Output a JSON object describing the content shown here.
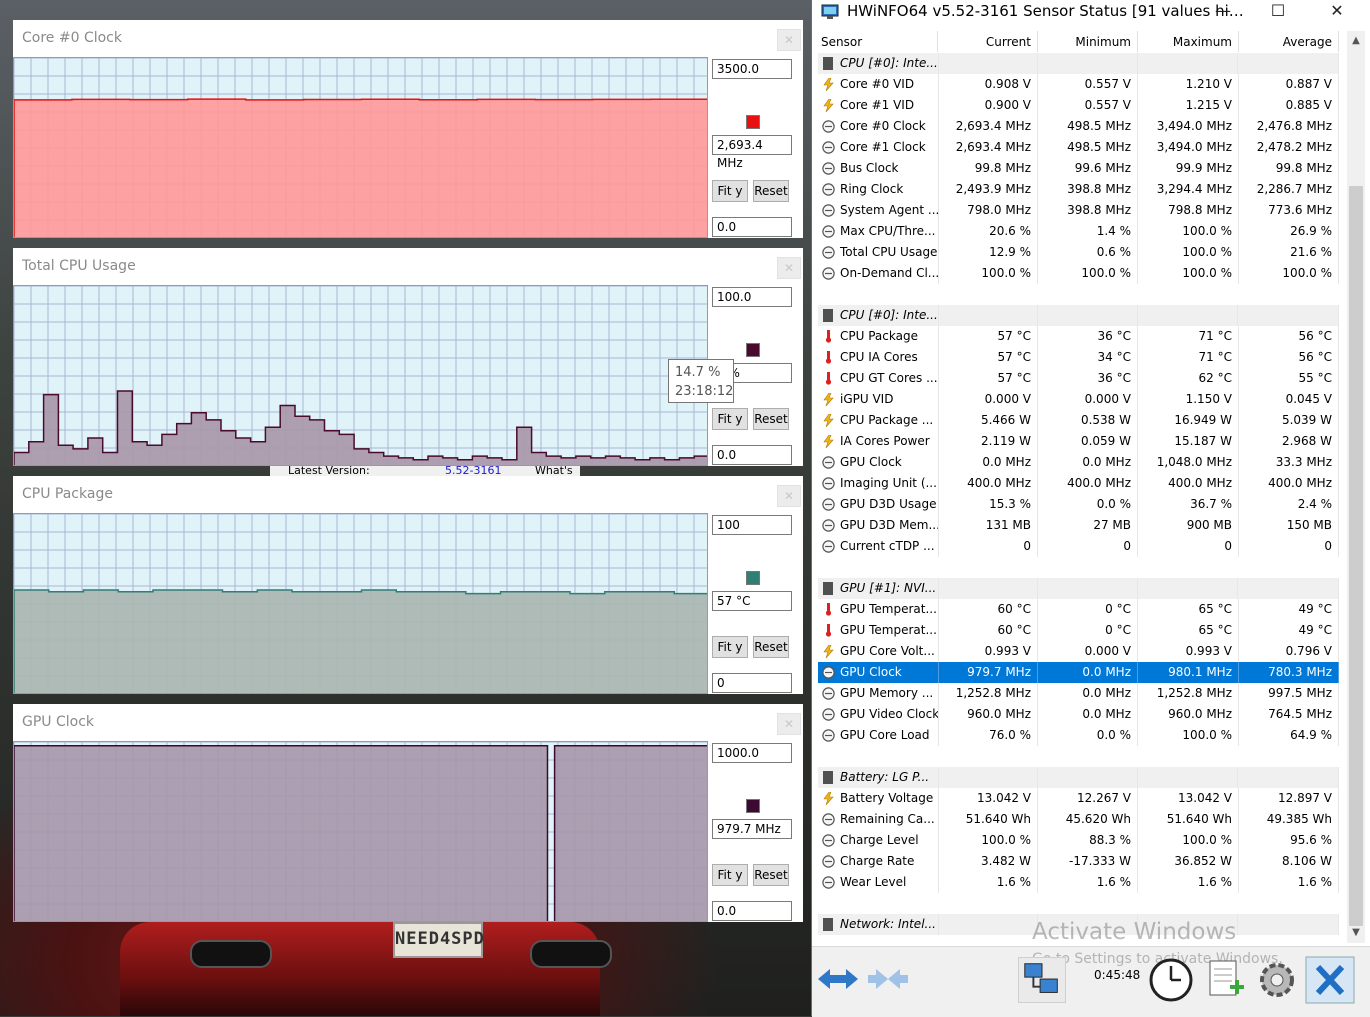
{
  "background": {
    "plate_text": "NEED4SPD",
    "dialog": {
      "latest_version_label": "Latest Version:",
      "latest_version_value": "5.52-3161",
      "whats_label": "What's"
    }
  },
  "graphs": [
    {
      "title": "Core #0 Clock",
      "max": "3500.0",
      "current": "2,693.4 MHz",
      "min": "0.0",
      "fit_label": "Fit y",
      "reset_label": "Reset",
      "color": "#e81010",
      "fill": "#ff9a9a"
    },
    {
      "title": "Total CPU Usage",
      "max": "100.0",
      "current": "12.9 %",
      "current_visible": "9 %",
      "min": "0.0",
      "fit_label": "Fit y",
      "reset_label": "Reset",
      "color": "#4a0a2e",
      "fill": "#a898a8"
    },
    {
      "title": "CPU Package",
      "max": "100",
      "current": "57 °C",
      "min": "0",
      "fit_label": "Fit y",
      "reset_label": "Reset",
      "color": "#2f7f74",
      "fill": "#a9b6b1"
    },
    {
      "title": "GPU Clock",
      "max": "1000.0",
      "current": "979.7 MHz",
      "min": "0.0",
      "fit_label": "Fit y",
      "reset_label": "Reset",
      "color": "#3c0a30",
      "fill": "#a698aa"
    }
  ],
  "tooltip": {
    "value": "14.7 %",
    "time": "23:18:12"
  },
  "chart_data": [
    {
      "type": "area",
      "title": "Core #0 Clock",
      "ylim": [
        0,
        3500
      ],
      "series": [
        {
          "name": "Core #0 Clock",
          "values": [
            2690,
            2700,
            2695,
            2705,
            2690,
            2698,
            2702,
            2693,
            2700,
            2695,
            2699,
            2701,
            2693
          ]
        }
      ]
    },
    {
      "type": "area",
      "title": "Total CPU Usage",
      "ylim": [
        0,
        100
      ],
      "series": [
        {
          "name": "Total CPU Usage",
          "values": [
            8,
            14,
            40,
            12,
            10,
            16,
            8,
            42,
            14,
            12,
            18,
            24,
            30,
            26,
            20,
            16,
            14,
            22,
            34,
            28,
            26,
            20,
            18,
            10,
            8,
            6,
            5,
            4,
            6,
            5,
            4,
            6,
            5,
            4,
            22,
            8,
            6,
            5,
            6,
            5,
            6,
            5,
            4,
            5,
            4,
            5,
            6,
            4
          ]
        }
      ]
    },
    {
      "type": "area",
      "title": "CPU Package",
      "ylim": [
        0,
        100
      ],
      "series": [
        {
          "name": "CPU Package",
          "values": [
            58,
            57,
            58,
            57,
            58,
            58,
            57,
            58,
            57,
            57,
            58,
            57,
            57,
            56,
            57,
            57,
            56,
            57,
            57,
            56,
            57
          ]
        }
      ]
    },
    {
      "type": "area",
      "title": "GPU Clock",
      "ylim": [
        0,
        1000
      ],
      "series": [
        {
          "name": "GPU Clock",
          "values": [
            979.7,
            979.7,
            979.7,
            979.7,
            979.7,
            979.7,
            979.7,
            979.7,
            979.7,
            979.7,
            979.7,
            979.7,
            979.7,
            979.7,
            979.7,
            979.7,
            979.7,
            979.7,
            979.7,
            979.7,
            979.7,
            979.7,
            979.7,
            979.7,
            979.7,
            979.7,
            979.7,
            979.7,
            979.7,
            979.7,
            979.7,
            979.7,
            979.7,
            979.7,
            979.7,
            979.7,
            979.7,
            979.7,
            979.7,
            979.7,
            979.7,
            979.7,
            979.7,
            979.7,
            979.7,
            979.7,
            979.7,
            979.7,
            979.7,
            979.7,
            979.7,
            979.7,
            979.7,
            979.7,
            979.7,
            979.7,
            979.7,
            979.7,
            979.7,
            979.7,
            979.7,
            979.7,
            979.7,
            979.7,
            979.7,
            979.7,
            979.7,
            979.7,
            979.7,
            979.7,
            979.7,
            979.7,
            979.7,
            979.7,
            979.7,
            979.7,
            0,
            979.7,
            979.7,
            979.7,
            979.7,
            979.7,
            979.7,
            979.7,
            979.7,
            979.7,
            979.7,
            979.7,
            979.7,
            979.7,
            979.7,
            979.7,
            979.7,
            979.7,
            979.7,
            979.7,
            979.7,
            979.7,
            979.7,
            979.7
          ]
        }
      ]
    }
  ],
  "hwinfo": {
    "title": "HWiNFO64 v5.52-3161 Sensor Status [91 values hi…",
    "columns": [
      "Sensor",
      "Current",
      "Minimum",
      "Maximum",
      "Average"
    ],
    "rows": [
      {
        "type": "group",
        "name": "CPU [#0]: Inte..."
      },
      {
        "icon": "lightning",
        "name": "Core #0 VID",
        "cur": "0.908 V",
        "min": "0.557 V",
        "max": "1.210 V",
        "avg": "0.887 V"
      },
      {
        "icon": "lightning",
        "name": "Core #1 VID",
        "cur": "0.900 V",
        "min": "0.557 V",
        "max": "1.215 V",
        "avg": "0.885 V"
      },
      {
        "icon": "gauge",
        "name": "Core #0 Clock",
        "cur": "2,693.4 MHz",
        "min": "498.5 MHz",
        "max": "3,494.0 MHz",
        "avg": "2,476.8 MHz"
      },
      {
        "icon": "gauge",
        "name": "Core #1 Clock",
        "cur": "2,693.4 MHz",
        "min": "498.5 MHz",
        "max": "3,494.0 MHz",
        "avg": "2,478.2 MHz"
      },
      {
        "icon": "gauge",
        "name": "Bus Clock",
        "cur": "99.8 MHz",
        "min": "99.6 MHz",
        "max": "99.9 MHz",
        "avg": "99.8 MHz"
      },
      {
        "icon": "gauge",
        "name": "Ring Clock",
        "cur": "2,493.9 MHz",
        "min": "398.8 MHz",
        "max": "3,294.4 MHz",
        "avg": "2,286.7 MHz"
      },
      {
        "icon": "gauge",
        "name": "System Agent ...",
        "cur": "798.0 MHz",
        "min": "398.8 MHz",
        "max": "798.8 MHz",
        "avg": "773.6 MHz"
      },
      {
        "icon": "gauge",
        "name": "Max CPU/Thre...",
        "cur": "20.6 %",
        "min": "1.4 %",
        "max": "100.0 %",
        "avg": "26.9 %"
      },
      {
        "icon": "gauge",
        "name": "Total CPU Usage",
        "cur": "12.9 %",
        "min": "0.6 %",
        "max": "100.0 %",
        "avg": "21.6 %"
      },
      {
        "icon": "gauge",
        "name": "On-Demand Cl...",
        "cur": "100.0 %",
        "min": "100.0 %",
        "max": "100.0 %",
        "avg": "100.0 %"
      },
      {
        "type": "blank"
      },
      {
        "type": "group",
        "name": "CPU [#0]: Inte..."
      },
      {
        "icon": "thermo",
        "name": "CPU Package",
        "cur": "57 °C",
        "min": "36 °C",
        "max": "71 °C",
        "avg": "56 °C"
      },
      {
        "icon": "thermo",
        "name": "CPU IA Cores",
        "cur": "57 °C",
        "min": "34 °C",
        "max": "71 °C",
        "avg": "56 °C"
      },
      {
        "icon": "thermo",
        "name": "CPU GT Cores ...",
        "cur": "57 °C",
        "min": "36 °C",
        "max": "62 °C",
        "avg": "55 °C"
      },
      {
        "icon": "lightning",
        "name": "iGPU VID",
        "cur": "0.000 V",
        "min": "0.000 V",
        "max": "1.150 V",
        "avg": "0.045 V"
      },
      {
        "icon": "lightning",
        "name": "CPU Package ...",
        "cur": "5.466 W",
        "min": "0.538 W",
        "max": "16.949 W",
        "avg": "5.039 W"
      },
      {
        "icon": "lightning",
        "name": "IA Cores Power",
        "cur": "2.119 W",
        "min": "0.059 W",
        "max": "15.187 W",
        "avg": "2.968 W"
      },
      {
        "icon": "gauge",
        "name": "GPU Clock",
        "cur": "0.0 MHz",
        "min": "0.0 MHz",
        "max": "1,048.0 MHz",
        "avg": "33.3 MHz"
      },
      {
        "icon": "gauge",
        "name": "Imaging Unit (...",
        "cur": "400.0 MHz",
        "min": "400.0 MHz",
        "max": "400.0 MHz",
        "avg": "400.0 MHz"
      },
      {
        "icon": "gauge",
        "name": "GPU D3D Usage",
        "cur": "15.3 %",
        "min": "0.0 %",
        "max": "36.7 %",
        "avg": "2.4 %"
      },
      {
        "icon": "gauge",
        "name": "GPU D3D Mem...",
        "cur": "131 MB",
        "min": "27 MB",
        "max": "900 MB",
        "avg": "150 MB"
      },
      {
        "icon": "gauge",
        "name": "Current cTDP ...",
        "cur": "0",
        "min": "0",
        "max": "0",
        "avg": "0"
      },
      {
        "type": "blank"
      },
      {
        "type": "group",
        "name": "GPU [#1]: NVI..."
      },
      {
        "icon": "thermo",
        "name": "GPU Temperat...",
        "cur": "60 °C",
        "min": "0 °C",
        "max": "65 °C",
        "avg": "49 °C"
      },
      {
        "icon": "thermo",
        "name": "GPU Temperat...",
        "cur": "60 °C",
        "min": "0 °C",
        "max": "65 °C",
        "avg": "49 °C"
      },
      {
        "icon": "lightning",
        "name": "GPU Core Volt...",
        "cur": "0.993 V",
        "min": "0.000 V",
        "max": "0.993 V",
        "avg": "0.796 V"
      },
      {
        "icon": "gauge",
        "name": "GPU Clock",
        "cur": "979.7 MHz",
        "min": "0.0 MHz",
        "max": "980.1 MHz",
        "avg": "780.3 MHz",
        "selected": true
      },
      {
        "icon": "gauge",
        "name": "GPU Memory ...",
        "cur": "1,252.8 MHz",
        "min": "0.0 MHz",
        "max": "1,252.8 MHz",
        "avg": "997.5 MHz"
      },
      {
        "icon": "gauge",
        "name": "GPU Video Clock",
        "cur": "960.0 MHz",
        "min": "0.0 MHz",
        "max": "960.0 MHz",
        "avg": "764.5 MHz"
      },
      {
        "icon": "gauge",
        "name": "GPU Core Load",
        "cur": "76.0 %",
        "min": "0.0 %",
        "max": "100.0 %",
        "avg": "64.9 %"
      },
      {
        "type": "blank"
      },
      {
        "type": "group",
        "name": "Battery: LG  P..."
      },
      {
        "icon": "lightning",
        "name": "Battery Voltage",
        "cur": "13.042 V",
        "min": "12.267 V",
        "max": "13.042 V",
        "avg": "12.897 V"
      },
      {
        "icon": "gauge",
        "name": "Remaining Ca...",
        "cur": "51.640 Wh",
        "min": "45.620 Wh",
        "max": "51.640 Wh",
        "avg": "49.385 Wh"
      },
      {
        "icon": "gauge",
        "name": "Charge Level",
        "cur": "100.0 %",
        "min": "88.3 %",
        "max": "100.0 %",
        "avg": "95.6 %"
      },
      {
        "icon": "gauge",
        "name": "Charge Rate",
        "cur": "3.482 W",
        "min": "-17.333 W",
        "max": "36.852 W",
        "avg": "8.106 W"
      },
      {
        "icon": "gauge",
        "name": "Wear Level",
        "cur": "1.6 %",
        "min": "1.6 %",
        "max": "1.6 %",
        "avg": "1.6 %"
      },
      {
        "type": "blank"
      },
      {
        "type": "group",
        "name": "Network: Intel..."
      }
    ],
    "timer": "0:45:48",
    "watermark": "Activate Windows",
    "watermark_sub": "Go to Settings to activate Windows."
  },
  "colors": {
    "selection": "#0078d7",
    "plot_bg": "#dff3f9",
    "grid": "#a9b7d6"
  }
}
